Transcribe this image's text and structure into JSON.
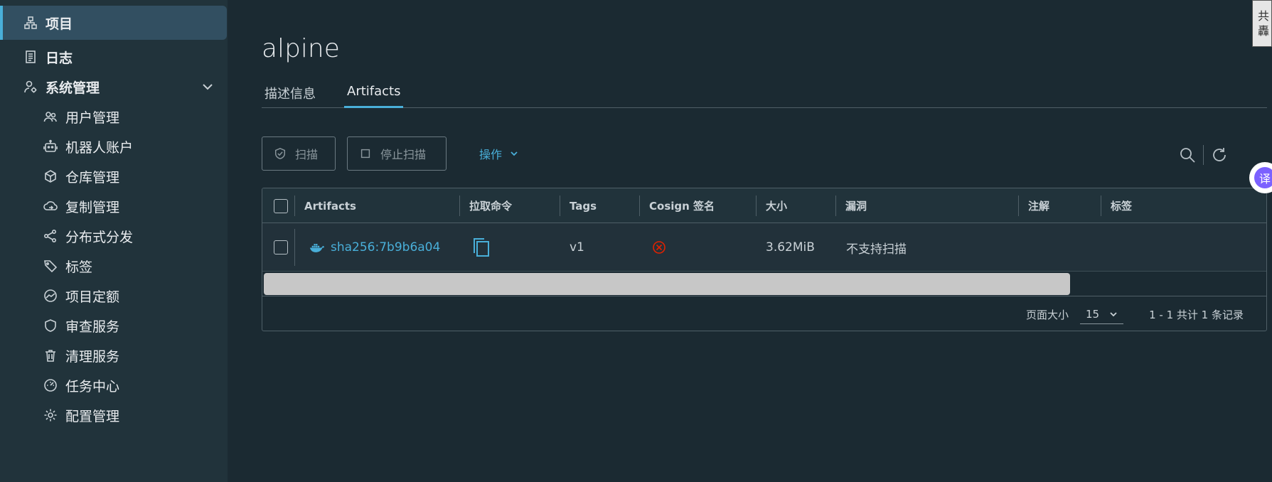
{
  "sidebar": {
    "items": [
      {
        "label": "项目",
        "icon": "project-icon"
      },
      {
        "label": "日志",
        "icon": "log-icon"
      },
      {
        "label": "系统管理",
        "icon": "system-admin-icon"
      },
      {
        "label": "用户管理",
        "icon": "users-icon"
      },
      {
        "label": "机器人账户",
        "icon": "robot-icon"
      },
      {
        "label": "仓库管理",
        "icon": "registry-icon"
      },
      {
        "label": "复制管理",
        "icon": "replication-icon"
      },
      {
        "label": "分布式分发",
        "icon": "distribution-icon"
      },
      {
        "label": "标签",
        "icon": "tag-icon"
      },
      {
        "label": "项目定额",
        "icon": "quota-icon"
      },
      {
        "label": "审查服务",
        "icon": "shield-icon"
      },
      {
        "label": "清理服务",
        "icon": "trash-icon"
      },
      {
        "label": "任务中心",
        "icon": "gauge-icon"
      },
      {
        "label": "配置管理",
        "icon": "gear-icon"
      }
    ]
  },
  "page": {
    "title": "alpine",
    "tabs": [
      {
        "label": "描述信息"
      },
      {
        "label": "Artifacts"
      }
    ]
  },
  "toolbar": {
    "scan_label": "扫描",
    "stop_scan_label": "停止扫描",
    "actions_label": "操作"
  },
  "table": {
    "headers": [
      "Artifacts",
      "拉取命令",
      "Tags",
      "Cosign 签名",
      "大小",
      "漏洞",
      "注解",
      "标签"
    ],
    "rows": [
      {
        "artifact": "sha256:7b9b6a04",
        "tags": "v1",
        "size": "3.62MiB",
        "vulnerability": "不支持扫描"
      }
    ],
    "scrollbar_position": 0
  },
  "pagination": {
    "page_size_label": "页面大小",
    "page_size": "15",
    "summary": "1 - 1 共计 1 条记录"
  },
  "widgets": {
    "side_tab_text": "共 轟",
    "translate_text": "译"
  },
  "colors": {
    "accent": "#49afd9",
    "error": "#e02200"
  }
}
